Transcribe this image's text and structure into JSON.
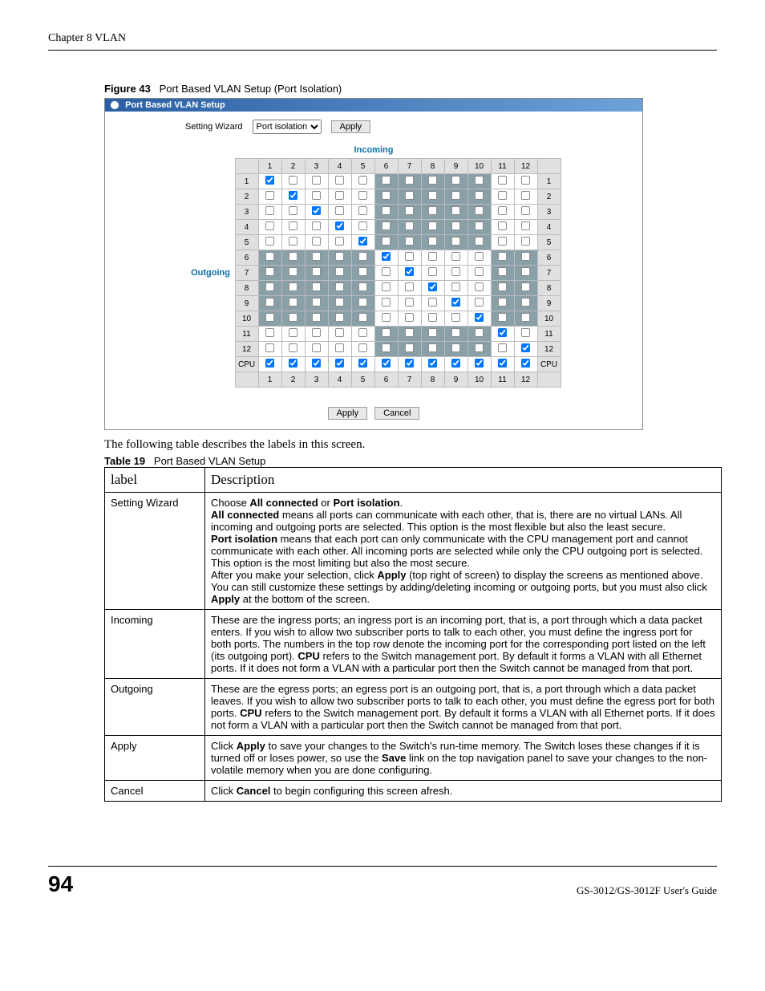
{
  "header": {
    "chapter": "Chapter 8 VLAN"
  },
  "figure": {
    "num": "Figure 43",
    "title": "Port Based VLAN Setup (Port Isolation)"
  },
  "shot": {
    "title": "Port Based VLAN Setup",
    "wizard_label": "Setting Wizard",
    "wizard_value": "Port isolation",
    "apply": "Apply",
    "incoming": "Incoming",
    "outgoing": "Outgoing",
    "cols": [
      "1",
      "2",
      "3",
      "4",
      "5",
      "6",
      "7",
      "8",
      "9",
      "10",
      "11",
      "12"
    ],
    "rows": [
      "1",
      "2",
      "3",
      "4",
      "5",
      "6",
      "7",
      "8",
      "9",
      "10",
      "11",
      "12",
      "CPU"
    ],
    "bottom_apply": "Apply",
    "bottom_cancel": "Cancel"
  },
  "intro": "The following table describes the labels in this screen.",
  "tcaption": {
    "num": "Table 19",
    "title": "Port Based VLAN Setup"
  },
  "thead": {
    "c1": "label",
    "c2": "Description"
  },
  "trow": [
    {
      "label": "Setting Wizard",
      "desc_html": "Choose <b>All connected</b> or <b>Port isolation</b>.<br><b>All connected</b> means all ports can communicate with each other, that is, there are no virtual LANs. All incoming and outgoing ports are selected. This option is the most flexible but also the least secure.<br><b>Port isolation</b> means that each port can only communicate with the CPU management port and cannot communicate with each other. All incoming ports are selected while only the CPU outgoing port is selected. This option is the most limiting but also the most secure.<br>After you make your selection, click <b>Apply</b> (top right of screen) to display the screens as mentioned above. You can still customize these settings by adding/deleting incoming or outgoing ports, but you must also click <b>Apply</b> at the bottom of the screen."
    },
    {
      "label": "Incoming",
      "desc_html": "These are the ingress ports; an ingress port is an incoming port, that is, a port through which a data packet enters. If you wish to allow two subscriber ports to talk to each other, you must define the ingress port for both ports. The numbers in the top row denote the incoming port for the corresponding port listed on the left (its outgoing port). <b>CPU</b> refers to the Switch management port. By default it forms a VLAN with all Ethernet ports. If it does not form a VLAN with a particular port then the Switch cannot be managed from that port."
    },
    {
      "label": "Outgoing",
      "desc_html": "These are the egress ports; an egress port is an outgoing port, that is, a port through which a data packet leaves. If you wish to allow two subscriber ports to talk to each other, you must define the egress port for both ports. <b>CPU</b> refers to the Switch management port. By default it forms a VLAN with all Ethernet ports. If it does not form a VLAN with a particular port then the Switch cannot be managed from that port."
    },
    {
      "label": "Apply",
      "desc_html": "Click <b>Apply</b> to save your changes to the Switch's run-time memory. The Switch loses these changes if it is turned off or loses power, so use the <b>Save</b> link on the top navigation panel to save your changes to the non-volatile memory when you are done configuring."
    },
    {
      "label": "Cancel",
      "desc_html": "Click <b>Cancel</b> to begin configuring this screen afresh."
    }
  ],
  "footer": {
    "page": "94",
    "guide": "GS-3012/GS-3012F User's Guide"
  },
  "chart_data": {
    "type": "table",
    "title": "Port Based VLAN checkbox matrix (Port Isolation)",
    "columns_incoming": [
      "1",
      "2",
      "3",
      "4",
      "5",
      "6",
      "7",
      "8",
      "9",
      "10",
      "11",
      "12"
    ],
    "rows_outgoing": [
      "1",
      "2",
      "3",
      "4",
      "5",
      "6",
      "7",
      "8",
      "9",
      "10",
      "11",
      "12",
      "CPU"
    ],
    "checked_pattern": "rows 1-12: only diagonal cell (row==col) checked; row CPU: all 12 checked",
    "shaded_blocks": [
      "rows1-5 cols6-10",
      "rows6-10 cols1-5",
      "rows6-10 cols11-12",
      "rows11-12 cols6-10"
    ]
  }
}
